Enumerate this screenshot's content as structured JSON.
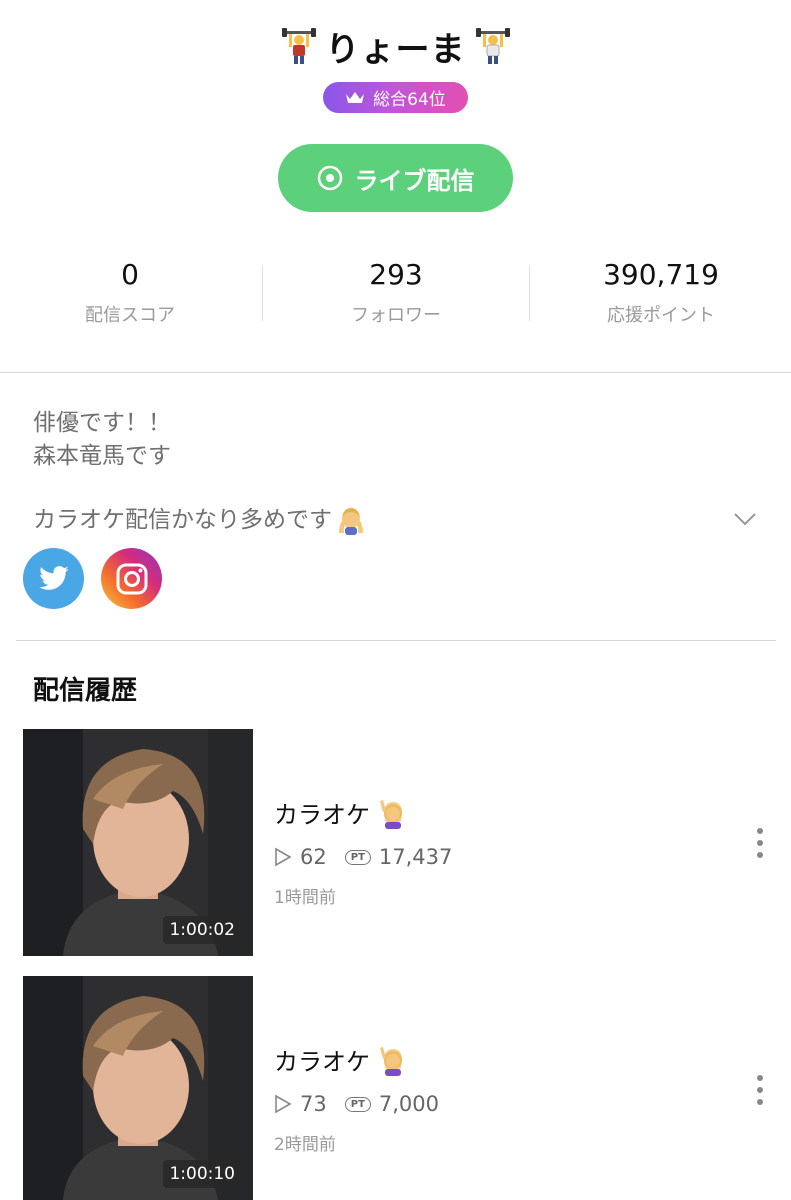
{
  "profile": {
    "name": "りょーま",
    "rank_label": "総合64位",
    "live_button_label": "ライブ配信"
  },
  "stats": [
    {
      "value": "0",
      "label": "配信スコア"
    },
    {
      "value": "293",
      "label": "フォロワー"
    },
    {
      "value": "390,719",
      "label": "応援ポイント"
    }
  ],
  "bio": {
    "lines": [
      "俳優です！！",
      "森本竜馬です"
    ],
    "extra": "カラオケ配信かなり多めです"
  },
  "social": {
    "twitter_icon": "twitter-icon",
    "instagram_icon": "instagram-icon"
  },
  "history": {
    "title": "配信履歴",
    "items": [
      {
        "title": "カラオケ",
        "views": "62",
        "points": "17,437",
        "time": "1時間前",
        "duration": "1:00:02"
      },
      {
        "title": "カラオケ",
        "views": "73",
        "points": "7,000",
        "time": "2時間前",
        "duration": "1:00:10"
      }
    ],
    "pt_badge": "PT"
  },
  "colors": {
    "live_green": "#5cd07a",
    "rank_gradient_start": "#8a56ea",
    "rank_gradient_end": "#e24fb0",
    "twitter_blue": "#4aa7e6"
  }
}
